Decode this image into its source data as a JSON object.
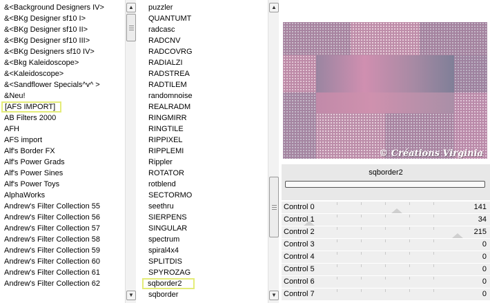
{
  "left_list": {
    "items": [
      "&<Background Designers IV>",
      "&<BKg Designer sf10 I>",
      "&<BKg Designer sf10 II>",
      "&<BKg Designer sf10 III>",
      "&<BKg Designers sf10 IV>",
      "&<Bkg Kaleidoscope>",
      "&<Kaleidoscope>",
      "&<Sandflower Specials^v^ >",
      "&Neu!",
      "[AFS IMPORT]",
      "AB Filters 2000",
      "AFH",
      "AFS import",
      "Alf's Border FX",
      "Alf's Power Grads",
      "Alf's Power Sines",
      "Alf's Power Toys",
      "AlphaWorks",
      "Andrew's Filter Collection 55",
      "Andrew's Filter Collection 56",
      "Andrew's Filter Collection 57",
      "Andrew's Filter Collection 58",
      "Andrew's Filter Collection 59",
      "Andrew's Filter Collection 60",
      "Andrew's Filter Collection 61",
      "Andrew's Filter Collection 62"
    ],
    "highlighted": "[AFS IMPORT]"
  },
  "mid_list": {
    "items": [
      "puzzler",
      "QUANTUMT",
      "radcasc",
      "RADCNV",
      "RADCOVRG",
      "RADIALZI",
      "RADSTREA",
      "RADTILEM",
      "randomnoise",
      "REALRADM",
      "RINGMIRR",
      "RINGTILE",
      "RIPPIXEL",
      "RIPPLEMI",
      "Rippler",
      "ROTATOR",
      "rotblend",
      "SECTORMO",
      "seethru",
      "SIERPENS",
      "SINGULAR",
      "spectrum",
      "spiral4x4",
      "SPLITDIS",
      "SPYROZAG",
      "sqborder2",
      "sqborder"
    ],
    "highlighted": "sqborder2"
  },
  "scrollbars": {
    "up_icon": "arrow-up-icon",
    "down_icon": "arrow-down-icon"
  },
  "preview": {
    "watermark": "© Créations Virginia",
    "colors": {
      "base": "#b58aa6",
      "pink": "#d293b0",
      "mauve": "#9a8297",
      "lavender": "#8e82a2",
      "dot": "#ffffff"
    }
  },
  "filter": {
    "name": "sqborder2",
    "progress": 0
  },
  "controls": [
    {
      "label": "Control 0",
      "value": "141",
      "level": 141
    },
    {
      "label": "Control 1",
      "value": "34",
      "level": 34
    },
    {
      "label": "Control 2",
      "value": "215",
      "level": 215
    },
    {
      "label": "Control 3",
      "value": "0",
      "level": 0
    },
    {
      "label": "Control 4",
      "value": "0",
      "level": 0
    },
    {
      "label": "Control 5",
      "value": "0",
      "level": 0
    },
    {
      "label": "Control 6",
      "value": "0",
      "level": 0
    },
    {
      "label": "Control 7",
      "value": "0",
      "level": 0
    }
  ]
}
